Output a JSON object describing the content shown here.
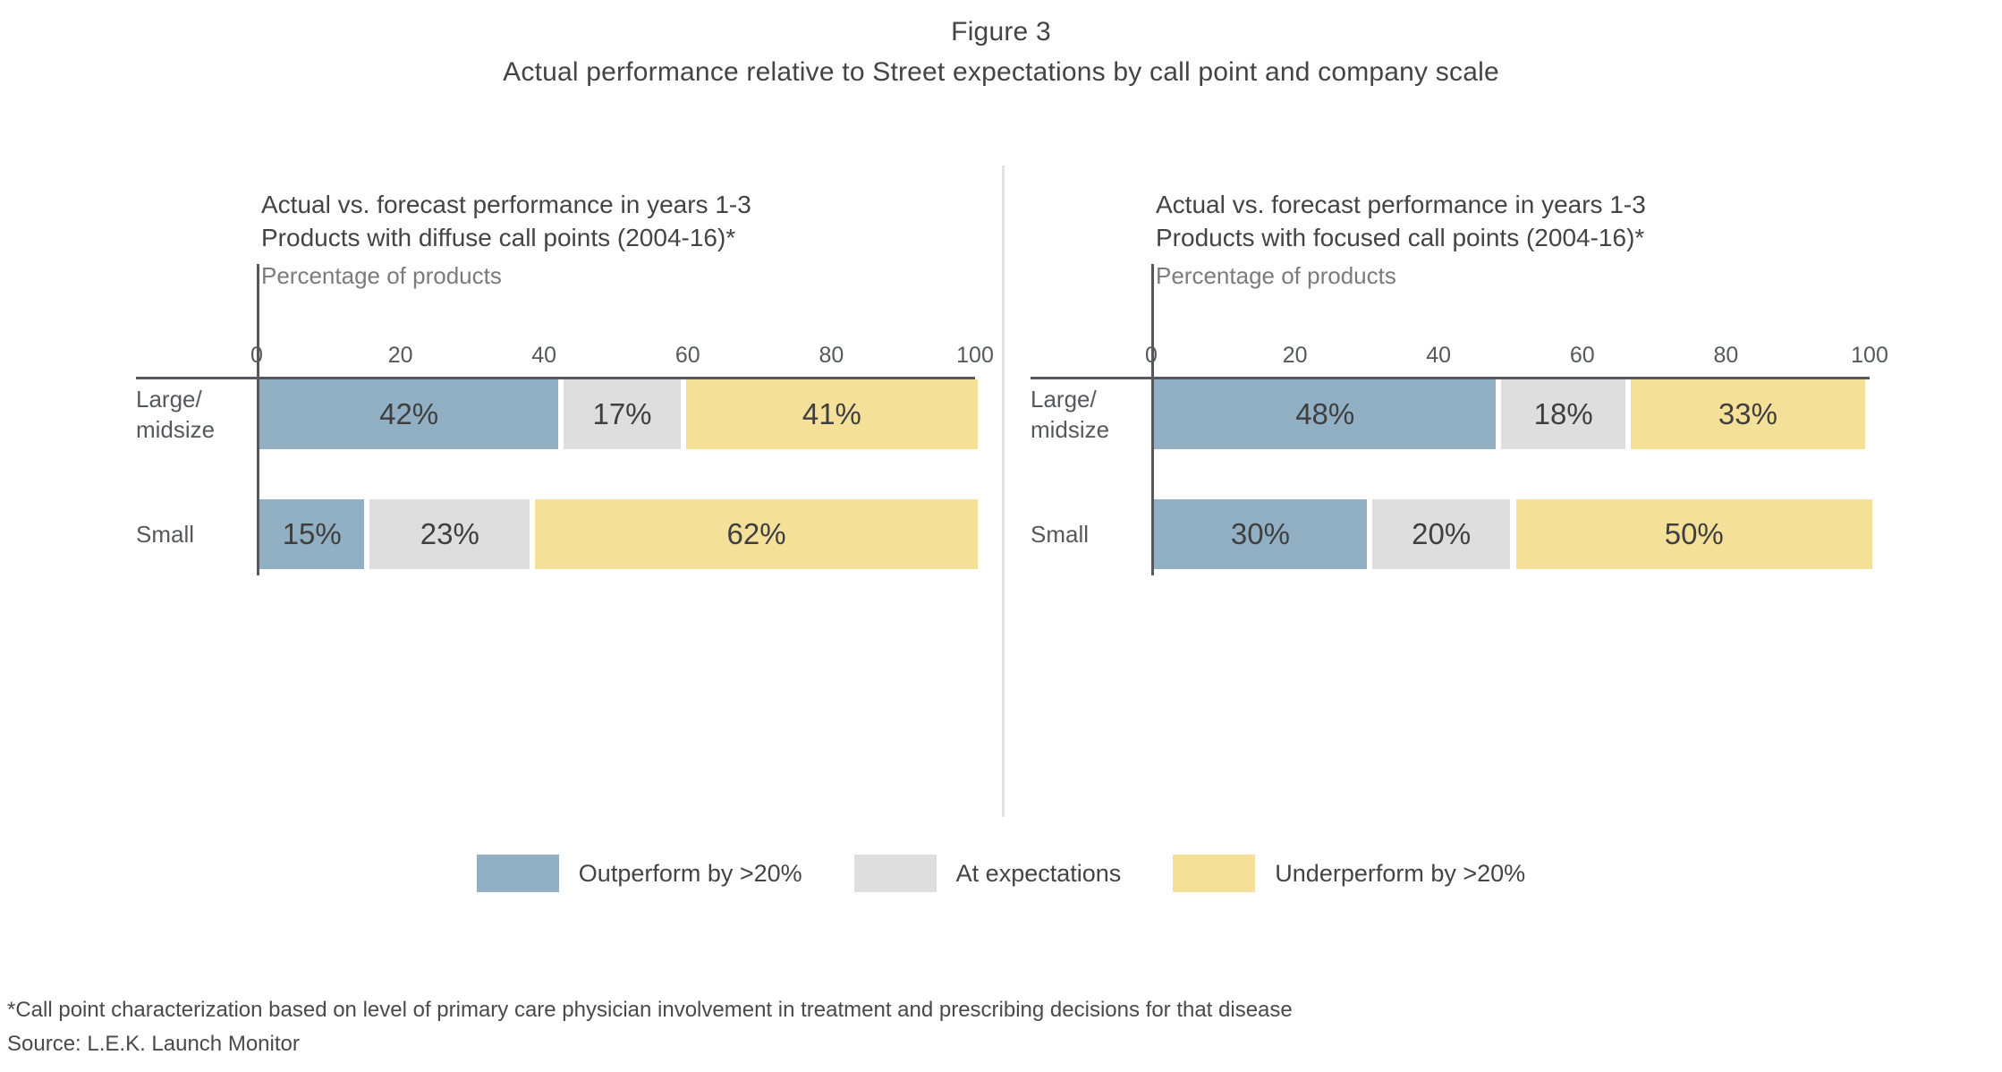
{
  "figure": {
    "number": "Figure 3",
    "title": "Actual performance relative to Street expectations by call point and company scale"
  },
  "panels": [
    {
      "head_line1": "Actual vs. forecast performance in years 1-3",
      "head_line2": "Products with diffuse call points (2004-16)*",
      "unit": "Percentage of products"
    },
    {
      "head_line1": "Actual vs. forecast performance in years 1-3",
      "head_line2": "Products with focused call points (2004-16)*",
      "unit": "Percentage of products"
    }
  ],
  "legend": {
    "items": [
      {
        "label": "Outperform by >20%",
        "color": "#91b0c4"
      },
      {
        "label": "At expectations",
        "color": "#dedede"
      },
      {
        "label": "Underperform by >20%",
        "color": "#f5e09a"
      }
    ]
  },
  "footnotes": {
    "line1": "*Call point characterization based on level of primary care physician involvement in treatment and prescribing decisions for that disease",
    "line2": "Source: L.E.K. Launch Monitor"
  },
  "chart_data": [
    {
      "type": "bar",
      "orientation": "horizontal",
      "stacked": true,
      "title": "Actual vs. forecast performance in years 1-3 / Products with diffuse call points (2004-16)*",
      "xlabel": "",
      "ylabel": "",
      "unit_label": "Percentage of products",
      "xlim": [
        0,
        100
      ],
      "xticks": [
        0,
        20,
        40,
        60,
        80,
        100
      ],
      "xtick_labels": [
        "0",
        "20",
        "40",
        "60",
        "80",
        "100"
      ],
      "grid": false,
      "legend_position": "bottom-center-shared",
      "categories": [
        "Large/midsize",
        "Small"
      ],
      "series": [
        {
          "name": "Outperform by >20%",
          "color": "#91b0c4",
          "values": [
            42,
            15
          ],
          "labels": [
            "42%",
            "15%"
          ]
        },
        {
          "name": "At expectations",
          "color": "#dedede",
          "values": [
            17,
            23
          ],
          "labels": [
            "17%",
            "23%"
          ]
        },
        {
          "name": "Underperform by >20%",
          "color": "#f5e09a",
          "values": [
            41,
            62
          ],
          "labels": [
            "41%",
            "62%"
          ]
        }
      ]
    },
    {
      "type": "bar",
      "orientation": "horizontal",
      "stacked": true,
      "title": "Actual vs. forecast performance in years 1-3 / Products with focused call points (2004-16)*",
      "xlabel": "",
      "ylabel": "",
      "unit_label": "Percentage of products",
      "xlim": [
        0,
        100
      ],
      "xticks": [
        0,
        20,
        40,
        60,
        80,
        100
      ],
      "xtick_labels": [
        "0",
        "20",
        "40",
        "60",
        "80",
        "100"
      ],
      "grid": false,
      "legend_position": "bottom-center-shared",
      "categories": [
        "Large/midsize",
        "Small"
      ],
      "series": [
        {
          "name": "Outperform by >20%",
          "color": "#91b0c4",
          "values": [
            48,
            30
          ],
          "labels": [
            "48%",
            "30%"
          ]
        },
        {
          "name": "At expectations",
          "color": "#dedede",
          "values": [
            18,
            20
          ],
          "labels": [
            "18%",
            "20%"
          ]
        },
        {
          "name": "Underperform by >20%",
          "color": "#f5e09a",
          "values": [
            33,
            50
          ],
          "labels": [
            "33%",
            "50%"
          ]
        }
      ]
    }
  ]
}
